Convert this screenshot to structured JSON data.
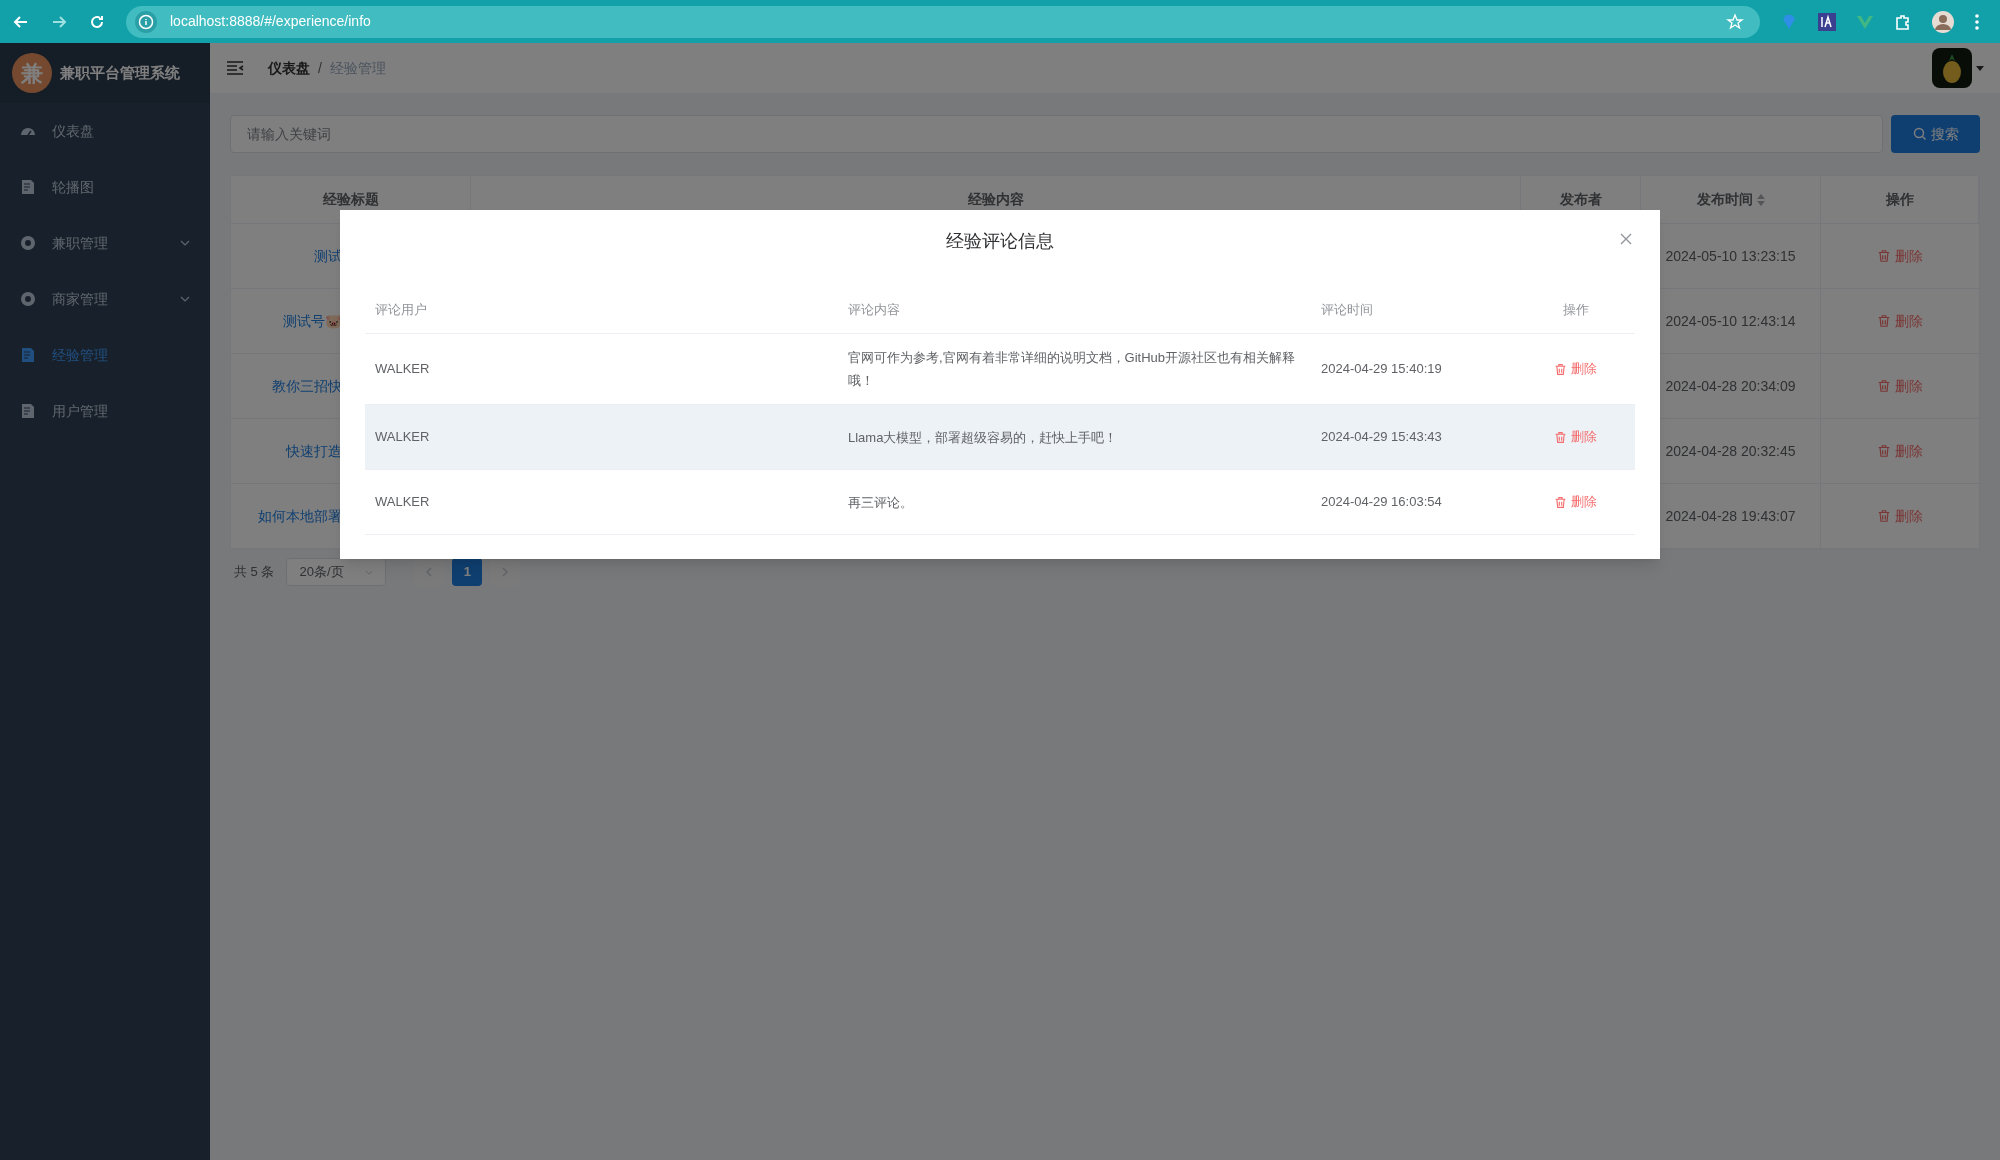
{
  "browser": {
    "url": "localhost:8888/#/experience/info"
  },
  "sidebar": {
    "title": "兼职平台管理系统",
    "logo_text": "兼",
    "items": [
      {
        "label": "仪表盘",
        "selected": false,
        "expandable": false
      },
      {
        "label": "轮播图",
        "selected": false,
        "expandable": false
      },
      {
        "label": "兼职管理",
        "selected": false,
        "expandable": true
      },
      {
        "label": "商家管理",
        "selected": false,
        "expandable": true
      },
      {
        "label": "经验管理",
        "selected": true,
        "expandable": false
      },
      {
        "label": "用户管理",
        "selected": false,
        "expandable": false
      }
    ]
  },
  "breadcrumb": {
    "separator": "/",
    "items": [
      {
        "label": "仪表盘",
        "current": false
      },
      {
        "label": "经验管理",
        "current": true
      }
    ]
  },
  "search": {
    "placeholder": "请输入关键词",
    "button": "搜索"
  },
  "table": {
    "columns": [
      {
        "label": "经验标题"
      },
      {
        "label": "经验内容"
      },
      {
        "label": "发布者"
      },
      {
        "label": "发布时间",
        "sortable": true
      },
      {
        "label": "操作"
      }
    ],
    "rows": [
      {
        "title": "测试",
        "time": "2024-05-10 13:23:15",
        "action": "删除"
      },
      {
        "title": "测试号🐷",
        "time": "2024-05-10 12:43:14",
        "action": "删除"
      },
      {
        "title": "教你三招快",
        "time": "2024-04-28 20:34:09",
        "action": "删除"
      },
      {
        "title": "快速打造",
        "time": "2024-04-28 20:32:45",
        "action": "删除"
      },
      {
        "title": "如何本地部署",
        "time": "2024-04-28 19:43:07",
        "action": "删除"
      }
    ]
  },
  "pagination": {
    "total": "共 5 条",
    "page_size": "20条/页",
    "pages": [
      {
        "label": "1",
        "selected": true
      }
    ]
  },
  "dialog": {
    "title": "经验评论信息",
    "columns": [
      "评论用户",
      "评论内容",
      "评论时间",
      "操作"
    ],
    "rows": [
      {
        "user": "WALKER",
        "content": "官网可作为参考,官网有着非常详细的说明文档，GitHub开源社区也有相关解释哦！",
        "time": "2024-04-29 15:40:19",
        "action": "删除",
        "hovered": false
      },
      {
        "user": "WALKER",
        "content": "Llama大模型，部署超级容易的，赶快上手吧！",
        "time": "2024-04-29 15:43:43",
        "action": "删除",
        "hovered": true
      },
      {
        "user": "WALKER",
        "content": "再三评论。",
        "time": "2024-04-29 16:03:54",
        "action": "删除",
        "hovered": false
      }
    ]
  }
}
